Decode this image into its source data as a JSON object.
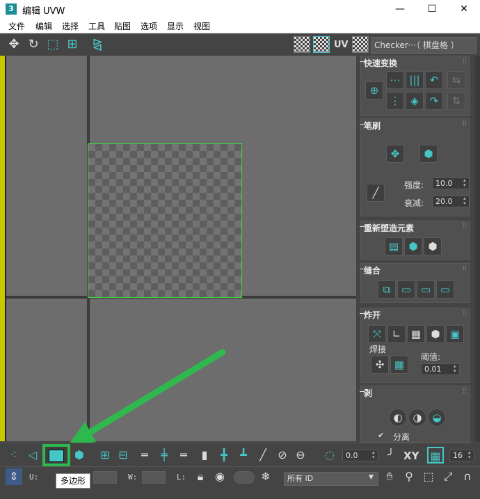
{
  "window": {
    "app_icon": "3",
    "title": "编辑 UVW",
    "min": "—",
    "max": "☐",
    "close": "✕"
  },
  "menu": [
    "文件",
    "编辑",
    "选择",
    "工具",
    "贴图",
    "选项",
    "显示",
    "视图"
  ],
  "toolbar": {
    "uv_label": "UV",
    "checker_select": "Checker···（ 棋盘格 ）",
    "icons": [
      "move-icon",
      "rotate-icon",
      "scale-icon",
      "freeform-icon",
      "mirror-icon",
      "checker-toggle-icon",
      "show-map-icon",
      "options-icon"
    ]
  },
  "rollouts": {
    "quick_transform": {
      "title": "快速变换"
    },
    "brush": {
      "title": "笔刷",
      "strength_label": "强度:",
      "strength_value": "10.0",
      "falloff_label": "衰减:",
      "falloff_value": "20.0"
    },
    "reshape": {
      "title": "重新塑造元素"
    },
    "stitch": {
      "title": "缝合"
    },
    "explode": {
      "title": "炸开",
      "weld_label": "焊接",
      "threshold_label": "阈值:",
      "threshold_value": "0.01"
    },
    "peel": {
      "title": "剥",
      "detach_label": "分离"
    }
  },
  "bottom": {
    "polygon_tooltip": "多边形",
    "spinner_value": "0.0",
    "xy_label": "XY",
    "grid_value": "16",
    "u_label": "U:",
    "w_label": "W:",
    "l_label": "L:",
    "id_select": "所有 ID"
  },
  "colors": {
    "accent": "#47c6c8",
    "highlight": "#2fb84e",
    "uv_edge": "#3dd93d"
  }
}
